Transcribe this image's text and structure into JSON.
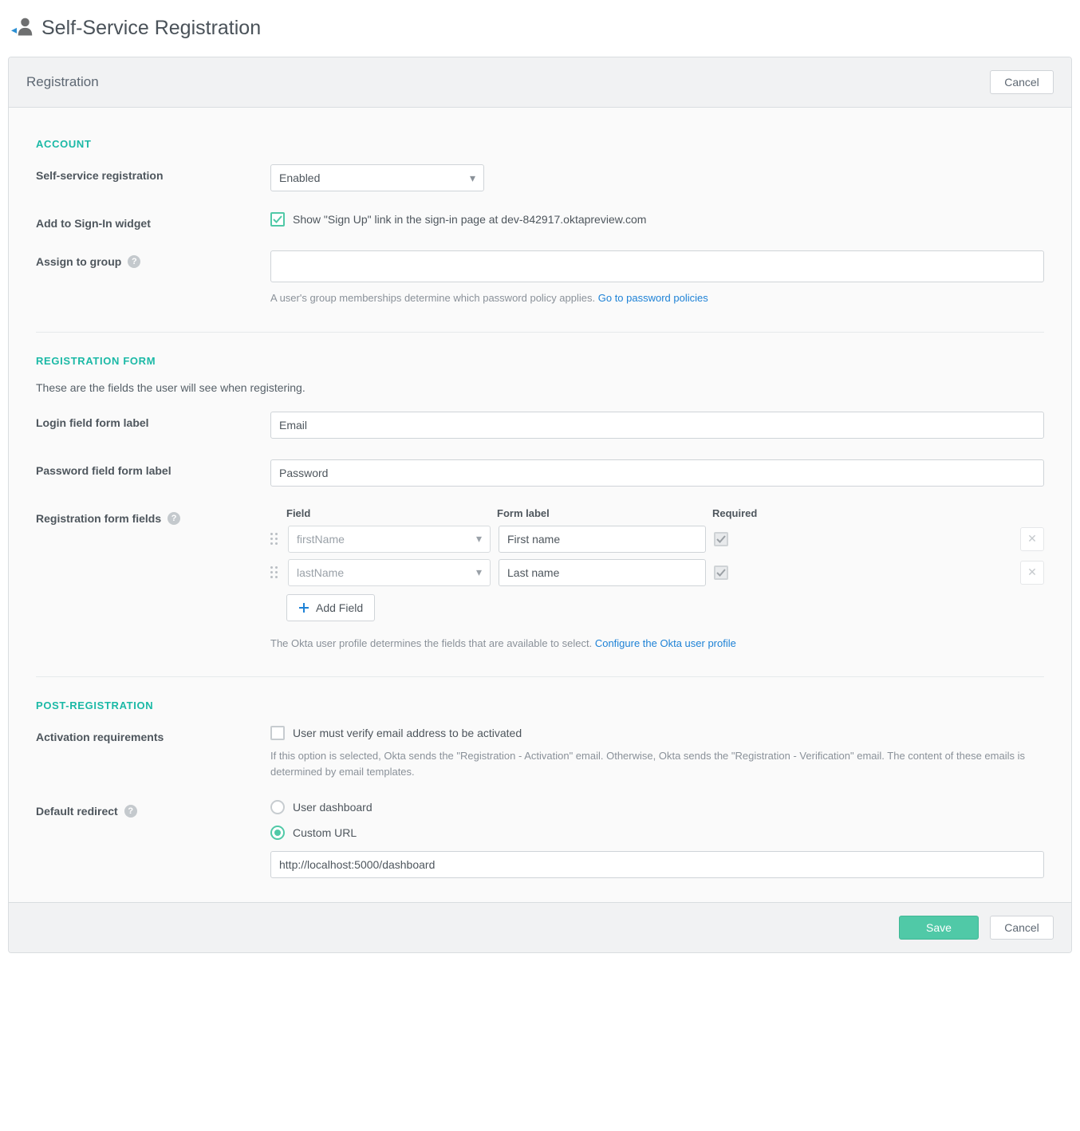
{
  "page_title": "Self-Service Registration",
  "panel": {
    "title": "Registration",
    "cancel_label": "Cancel"
  },
  "account": {
    "section_title": "ACCOUNT",
    "ssr_label": "Self-service registration",
    "ssr_value": "Enabled",
    "add_widget_label": "Add to Sign-In widget",
    "add_widget_checked": true,
    "add_widget_text": "Show \"Sign Up\" link in the sign-in page at dev-842917.oktapreview.com",
    "assign_group_label": "Assign to group",
    "assign_group_help": "A user's group memberships determine which password policy applies. ",
    "assign_group_link": "Go to password policies"
  },
  "reg_form": {
    "section_title": "REGISTRATION FORM",
    "subtitle": "These are the fields the user will see when registering.",
    "login_label": "Login field form label",
    "login_value": "Email",
    "password_label": "Password field form label",
    "password_value": "Password",
    "fields_label": "Registration form fields",
    "columns": {
      "field": "Field",
      "form_label": "Form label",
      "required": "Required"
    },
    "rows": [
      {
        "field": "firstName",
        "label": "First name",
        "required": true
      },
      {
        "field": "lastName",
        "label": "Last name",
        "required": true
      }
    ],
    "add_field_label": "Add Field",
    "help_text": "The Okta user profile determines the fields that are available to select. ",
    "help_link": "Configure the Okta user profile"
  },
  "post_reg": {
    "section_title": "POST-REGISTRATION",
    "activation_label": "Activation requirements",
    "activation_checked": false,
    "activation_text": "User must verify email address to be activated",
    "activation_help": "If this option is selected, Okta sends the \"Registration - Activation\" email. Otherwise, Okta sends the \"Registration - Verification\" email. The content of these emails is determined by email templates.",
    "redirect_label": "Default redirect",
    "redirect_option_dashboard": "User dashboard",
    "redirect_option_custom": "Custom URL",
    "redirect_selected": "custom",
    "redirect_url": "http://localhost:5000/dashboard"
  },
  "footer": {
    "save_label": "Save",
    "cancel_label": "Cancel"
  }
}
